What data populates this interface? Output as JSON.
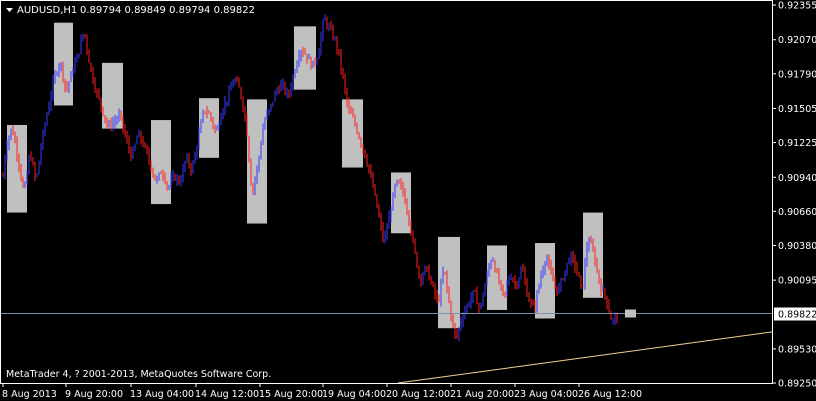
{
  "window": {
    "symbol_title": "AUDUSD,H1",
    "ohlc_text": "0.89794 0.89849 0.89794 0.89822",
    "copyright": "MetaTrader 4, ? 2001-2013, MetaQuotes Software Corp.",
    "menu_icon": "triangle-down-icon"
  },
  "colors": {
    "background": "#000000",
    "axis": "#ffffff",
    "bull_candle": "#3a3aff",
    "bear_candle": "#ff2020",
    "highlight_box": "#c0c0c0",
    "bid_line": "#8090a8",
    "trend_line": "#f5cf9a"
  },
  "price_axis": {
    "ticks": [
      "0.92355",
      "0.92070",
      "0.91790",
      "0.91505",
      "0.91225",
      "0.90940",
      "0.90660",
      "0.90380",
      "0.90095",
      "0.89530",
      "0.89250"
    ],
    "current_price": "0.89822"
  },
  "time_axis": {
    "ticks": [
      "8 Aug 2013",
      "9 Aug 20:00",
      "13 Aug 04:00",
      "14 Aug 12:00",
      "15 Aug 20:00",
      "19 Aug 04:00",
      "20 Aug 12:00",
      "21 Aug 20:00",
      "23 Aug 04:00",
      "26 Aug 12:00"
    ]
  },
  "chart_data": {
    "type": "candlestick",
    "symbol": "AUDUSD",
    "timeframe": "H1",
    "y_range": [
      0.8925,
      0.9238
    ],
    "last_bar": {
      "open": 0.89794,
      "high": 0.89849,
      "low": 0.89794,
      "close": 0.89822
    },
    "current_price": 0.89822,
    "price_path": [
      [
        0,
        0.907
      ],
      [
        6,
        0.912
      ],
      [
        12,
        0.9135
      ],
      [
        18,
        0.911
      ],
      [
        24,
        0.908
      ],
      [
        30,
        0.9115
      ],
      [
        36,
        0.909
      ],
      [
        42,
        0.9125
      ],
      [
        48,
        0.915
      ],
      [
        54,
        0.9175
      ],
      [
        60,
        0.919
      ],
      [
        66,
        0.9165
      ],
      [
        72,
        0.918
      ],
      [
        78,
        0.9195
      ],
      [
        84,
        0.9215
      ],
      [
        90,
        0.9185
      ],
      [
        96,
        0.9165
      ],
      [
        102,
        0.915
      ],
      [
        108,
        0.9135
      ],
      [
        114,
        0.914
      ],
      [
        120,
        0.9145
      ],
      [
        126,
        0.9125
      ],
      [
        132,
        0.911
      ],
      [
        138,
        0.913
      ],
      [
        144,
        0.912
      ],
      [
        150,
        0.9105
      ],
      [
        156,
        0.909
      ],
      [
        162,
        0.91
      ],
      [
        168,
        0.9085
      ],
      [
        174,
        0.9095
      ],
      [
        180,
        0.909
      ],
      [
        186,
        0.911
      ],
      [
        192,
        0.91
      ],
      [
        198,
        0.9125
      ],
      [
        204,
        0.915
      ],
      [
        210,
        0.9145
      ],
      [
        216,
        0.913
      ],
      [
        222,
        0.915
      ],
      [
        228,
        0.916
      ],
      [
        234,
        0.9175
      ],
      [
        240,
        0.9165
      ],
      [
        246,
        0.914
      ],
      [
        252,
        0.908
      ],
      [
        258,
        0.9105
      ],
      [
        264,
        0.914
      ],
      [
        270,
        0.915
      ],
      [
        276,
        0.9165
      ],
      [
        282,
        0.917
      ],
      [
        288,
        0.916
      ],
      [
        294,
        0.918
      ],
      [
        300,
        0.92
      ],
      [
        306,
        0.9195
      ],
      [
        312,
        0.9185
      ],
      [
        318,
        0.9195
      ],
      [
        324,
        0.9225
      ],
      [
        330,
        0.9215
      ],
      [
        336,
        0.9205
      ],
      [
        342,
        0.918
      ],
      [
        348,
        0.915
      ],
      [
        354,
        0.914
      ],
      [
        360,
        0.9125
      ],
      [
        366,
        0.911
      ],
      [
        372,
        0.909
      ],
      [
        378,
        0.9065
      ],
      [
        384,
        0.904
      ],
      [
        390,
        0.9065
      ],
      [
        396,
        0.909
      ],
      [
        402,
        0.9085
      ],
      [
        408,
        0.9065
      ],
      [
        414,
        0.9035
      ],
      [
        420,
        0.901
      ],
      [
        426,
        0.902
      ],
      [
        432,
        0.9005
      ],
      [
        438,
        0.899
      ],
      [
        444,
        0.902
      ],
      [
        450,
        0.8985
      ],
      [
        456,
        0.896
      ],
      [
        462,
        0.898
      ],
      [
        468,
        0.899
      ],
      [
        474,
        0.9
      ],
      [
        480,
        0.8985
      ],
      [
        486,
        0.901
      ],
      [
        492,
        0.903
      ],
      [
        498,
        0.901
      ],
      [
        504,
        0.8995
      ],
      [
        510,
        0.9015
      ],
      [
        516,
        0.9005
      ],
      [
        522,
        0.902
      ],
      [
        528,
        0.8995
      ],
      [
        534,
        0.8985
      ],
      [
        540,
        0.901
      ],
      [
        546,
        0.903
      ],
      [
        552,
        0.901
      ],
      [
        558,
        0.9
      ],
      [
        564,
        0.9015
      ],
      [
        570,
        0.903
      ],
      [
        576,
        0.902
      ],
      [
        582,
        0.9
      ],
      [
        588,
        0.9045
      ],
      [
        594,
        0.903
      ],
      [
        600,
        0.9005
      ],
      [
        606,
        0.8995
      ],
      [
        612,
        0.8975
      ],
      [
        618,
        0.8982
      ]
    ],
    "highlight_zones": [
      [
        7,
        27,
        0.9065,
        0.9137
      ],
      [
        54,
        73,
        0.9153,
        0.9221
      ],
      [
        102,
        123,
        0.9134,
        0.9188
      ],
      [
        151,
        171,
        0.9072,
        0.9141
      ],
      [
        199,
        219,
        0.911,
        0.9159
      ],
      [
        247,
        267,
        0.9056,
        0.9158
      ],
      [
        294,
        316,
        0.9166,
        0.9218
      ],
      [
        342,
        363,
        0.9102,
        0.9158
      ],
      [
        391,
        411,
        0.9048,
        0.9098
      ],
      [
        438,
        460,
        0.897,
        0.9045
      ],
      [
        487,
        507,
        0.8985,
        0.9038
      ],
      [
        535,
        555,
        0.8978,
        0.904
      ],
      [
        583,
        603,
        0.8995,
        0.9065
      ]
    ],
    "trend_line": [
      [
        398,
        0.8925
      ],
      [
        772,
        0.8967
      ]
    ]
  }
}
